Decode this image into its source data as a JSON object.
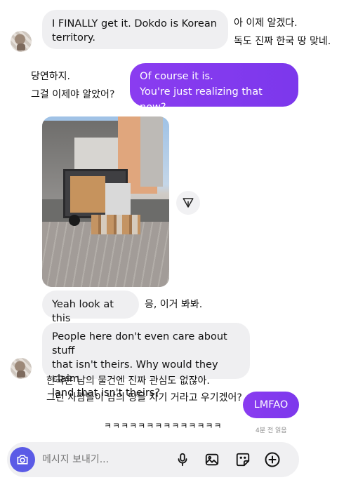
{
  "messages": {
    "m1": {
      "text": "I FINALLY get it. Dokdo is Korean territory.",
      "line1": "I FINALLY get it. Dokdo is Korean",
      "line2": "territory.",
      "caption_line1": "아 이제 알겠다.",
      "caption_line2": "독도 진짜 한국 땅 맞네."
    },
    "m2": {
      "line1": "Of course it is.",
      "line2": "You're just realizing that now?",
      "caption_line1": "당연하지.",
      "caption_line2": "그걸 이제야 알았어?"
    },
    "m3": {
      "text": "Yeah look at this",
      "caption": "응, 이거 봐봐."
    },
    "m4": {
      "line1": "People here don't even care about stuff",
      "line2": "that isn't theirs. Why would they claim",
      "line3": "land that isn't theirs?",
      "caption_line1": "한국은 남의 물건엔 진짜 관심도 없잖아.",
      "caption_line2": "그런 사람들이 남의 땅을 자기 거라고 우기겠어?"
    },
    "m5": {
      "text": "LMFAO",
      "caption": "ㅋㅋㅋㅋㅋㅋㅋㅋㅋㅋㅋㅋㅋㅋ",
      "read_status": "4분 전 읽음"
    }
  },
  "composer": {
    "placeholder": "메시지 보내기..."
  },
  "icons": {
    "camera": "camera-icon",
    "mic": "microphone-icon",
    "gallery": "image-icon",
    "sticker": "sticker-icon",
    "add": "plus-circle-icon",
    "share": "share-icon"
  },
  "colors": {
    "outgoing_bubble": "#8a3cf0",
    "incoming_bubble": "#efeff1",
    "camera_button": "#5b5be6"
  }
}
